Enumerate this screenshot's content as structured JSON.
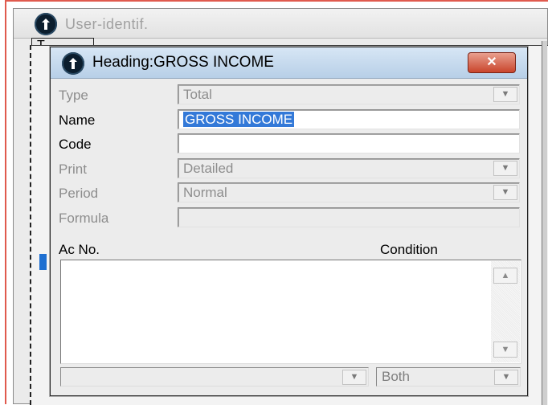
{
  "background_window": {
    "title": "User-identif.",
    "column_header": "T"
  },
  "dialog": {
    "title": "Heading:GROSS INCOME",
    "close_label": "✕",
    "fields": {
      "type": {
        "label": "Type",
        "value": "Total"
      },
      "name": {
        "label": "Name",
        "value": "GROSS INCOME"
      },
      "code": {
        "label": "Code",
        "value": ""
      },
      "print": {
        "label": "Print",
        "value": "Detailed"
      },
      "period": {
        "label": "Period",
        "value": "Normal"
      },
      "formula": {
        "label": "Formula",
        "value": ""
      }
    },
    "list": {
      "col_acno": "Ac No.",
      "col_condition": "Condition"
    },
    "bottom": {
      "left_value": "",
      "condition_value": "Both"
    }
  },
  "colors": {
    "titlebar": "#b7cfe7",
    "selection": "#3379d8",
    "close": "#c9452c",
    "accent_blue": "#1e6fd1"
  }
}
